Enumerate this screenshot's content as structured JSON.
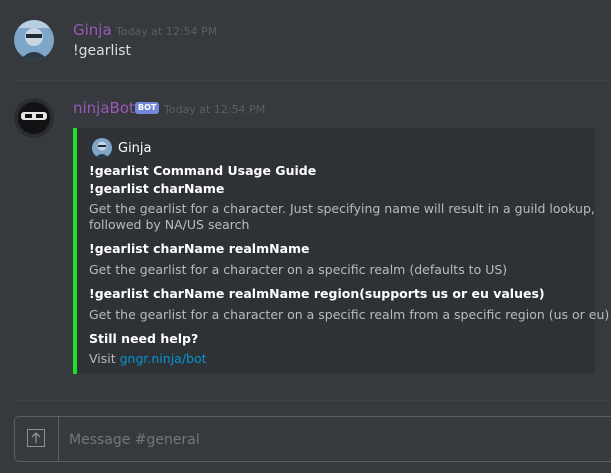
{
  "messages": [
    {
      "username": "Ginja",
      "username_color": "#9b59b6",
      "timestamp": "Today at 12:54 PM",
      "text": "!gearlist"
    },
    {
      "username": "ninjaBot",
      "username_color": "#9b59b6",
      "bot_tag": "BOT",
      "timestamp": "Today at 12:54 PM",
      "embed": {
        "accent_color": "#1ee123",
        "author": "Ginja",
        "lines": [
          "!gearlist Command Usage Guide",
          "!gearlist charName",
          "Get the gearlist for a character. Just specifying name will result in a guild lookup,",
          "followed by NA/US search",
          "!gearlist charName realmName",
          "Get the gearlist for a character on a specific realm (defaults to US)",
          "!gearlist charName realmName region(supports us or eu values)",
          "Get the gearlist for a character on a specific realm from a specific region (us or eu)",
          "Still need help?"
        ],
        "visit_text": "Visit",
        "link_text": "gngr.ninja/bot"
      }
    }
  ],
  "composer": {
    "placeholder": "Message #general",
    "upload_icon": "upload-arrow-icon"
  }
}
